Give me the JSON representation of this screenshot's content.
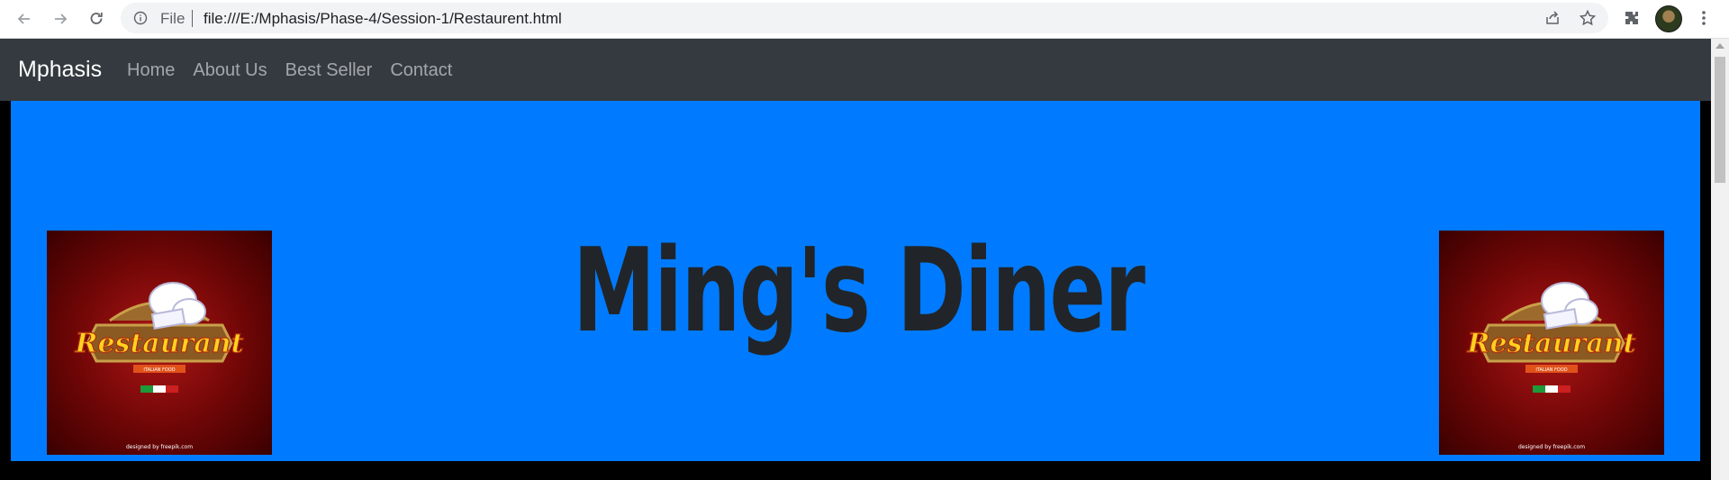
{
  "browser": {
    "scheme_label": "File",
    "url": "file:///E:/Mphasis/Phase-4/Session-1/Restaurent.html"
  },
  "site": {
    "brand": "Mphasis",
    "nav_links": [
      "Home",
      "About Us",
      "Best Seller",
      "Contact"
    ]
  },
  "hero": {
    "title": "Ming's Diner",
    "background_color": "#007bff",
    "logo": {
      "banner_text": "Restaurant",
      "sub_text": "ITALIAN FOOD",
      "credit": "designed by freepik.com"
    }
  },
  "colors": {
    "navbar": "#343a40",
    "hero": "#007bff",
    "title": "#212529"
  }
}
